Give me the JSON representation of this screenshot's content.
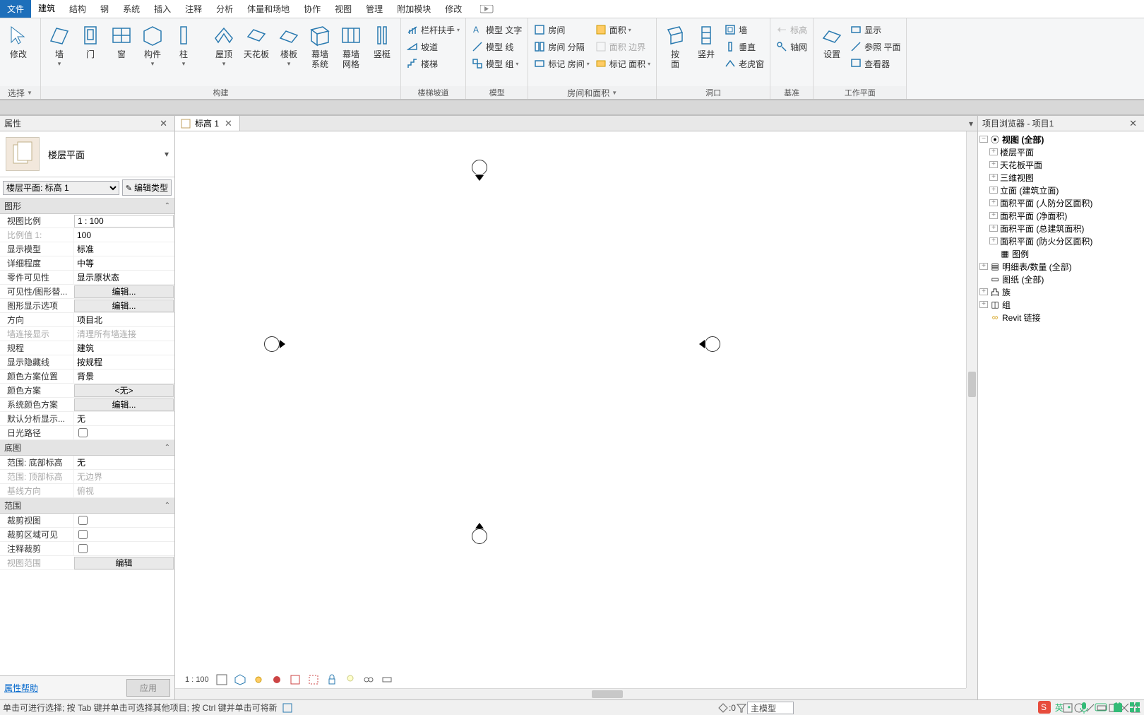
{
  "menu": [
    "文件",
    "建筑",
    "结构",
    "钢",
    "系统",
    "插入",
    "注释",
    "分析",
    "体量和场地",
    "协作",
    "视图",
    "管理",
    "附加模块",
    "修改"
  ],
  "menu_active_file_idx": 0,
  "menu_active_idx": 1,
  "ribbon": {
    "select": {
      "modify": "修改",
      "group": "选择"
    },
    "build": {
      "wall": "墙",
      "door": "门",
      "window": "窗",
      "component": "构件",
      "column": "柱",
      "roof": "屋顶",
      "ceiling": "天花板",
      "floor": "楼板",
      "curtain_sys": "幕墙\n系统",
      "curtain_grid": "幕墙\n网格",
      "mullion": "竖梃",
      "group": "构建"
    },
    "circ": {
      "rail": "栏杆扶手",
      "ramp": "坡道",
      "stair": "楼梯",
      "group": "楼梯坡道"
    },
    "model": {
      "text": "模型 文字",
      "line": "模型 线",
      "grp": "模型 组",
      "group": "模型"
    },
    "room": {
      "room": "房间",
      "room_sep": "房间 分隔",
      "tag_room": "标记 房间",
      "area": "面积",
      "area_bound": "面积 边界",
      "tag_area": "标记 面积",
      "group": "房间和面积"
    },
    "opening": {
      "byface": "按\n面",
      "shaft": "竖井",
      "wall": "墙",
      "vertical": "垂直",
      "dormer": "老虎窗",
      "group": "洞口"
    },
    "datum": {
      "level": "标高",
      "grid": "轴网",
      "group": "基准"
    },
    "workplane": {
      "set": "设置",
      "show": "显示",
      "ref": "参照 平面",
      "viewer": "查看器",
      "group": "工作平面"
    }
  },
  "properties": {
    "title": "属性",
    "type_name": "楼层平面",
    "instance_sel": "楼层平面: 标高 1",
    "edit_type": "编辑类型",
    "sections": {
      "graphics": "图形",
      "underlay": "底图",
      "extent": "范围"
    },
    "rows": {
      "view_scale_k": "视图比例",
      "view_scale_v": "1 : 100",
      "scale_value_k": "比例值 1:",
      "scale_value_v": "100",
      "display_model_k": "显示模型",
      "display_model_v": "标准",
      "detail_k": "详细程度",
      "detail_v": "中等",
      "part_vis_k": "零件可见性",
      "part_vis_v": "显示原状态",
      "vg_k": "可见性/图形替...",
      "vg_v": "编辑...",
      "gds_k": "图形显示选项",
      "gds_v": "编辑...",
      "orient_k": "方向",
      "orient_v": "项目北",
      "walljoin_k": "墙连接显示",
      "walljoin_v": "清理所有墙连接",
      "discipline_k": "规程",
      "discipline_v": "建筑",
      "hidden_k": "显示隐藏线",
      "hidden_v": "按规程",
      "color_loc_k": "颜色方案位置",
      "color_loc_v": "背景",
      "color_k": "颜色方案",
      "color_v": "<无>",
      "sys_color_k": "系统颜色方案",
      "sys_color_v": "编辑...",
      "default_k": "默认分析显示...",
      "default_v": "无",
      "sunpath_k": "日光路径",
      "ext_bot_k": "范围: 底部标高",
      "ext_bot_v": "无",
      "ext_top_k": "范围: 顶部标高",
      "ext_top_v": "无边界",
      "base_dir_k": "基线方向",
      "base_dir_v": "俯视",
      "crop_k": "裁剪视图",
      "crop_vis_k": "裁剪区域可见",
      "anno_crop_k": "注释裁剪",
      "view_range_k": "视图范围",
      "view_range_v": "编辑"
    },
    "help": "属性帮助",
    "apply": "应用"
  },
  "view_tab": {
    "name": "标高 1"
  },
  "view_scale_label": "1 : 100",
  "browser": {
    "title": "项目浏览器 - 项目1",
    "views_root": "视图 (全部)",
    "items": [
      "楼层平面",
      "天花板平面",
      "三维视图",
      "立面 (建筑立面)",
      "面积平面 (人防分区面积)",
      "面积平面 (净面积)",
      "面积平面 (总建筑面积)",
      "面积平面 (防火分区面积)"
    ],
    "legend": "图例",
    "schedules": "明细表/数量 (全部)",
    "sheets": "图纸 (全部)",
    "families": "族",
    "groups": "组",
    "links": "Revit 链接"
  },
  "status": {
    "hint": "单击可进行选择; 按 Tab 键并单击可选择其他项目; 按 Ctrl 键并单击可将新",
    "zero": ":0",
    "filter": "主模型",
    "ime": "英"
  }
}
